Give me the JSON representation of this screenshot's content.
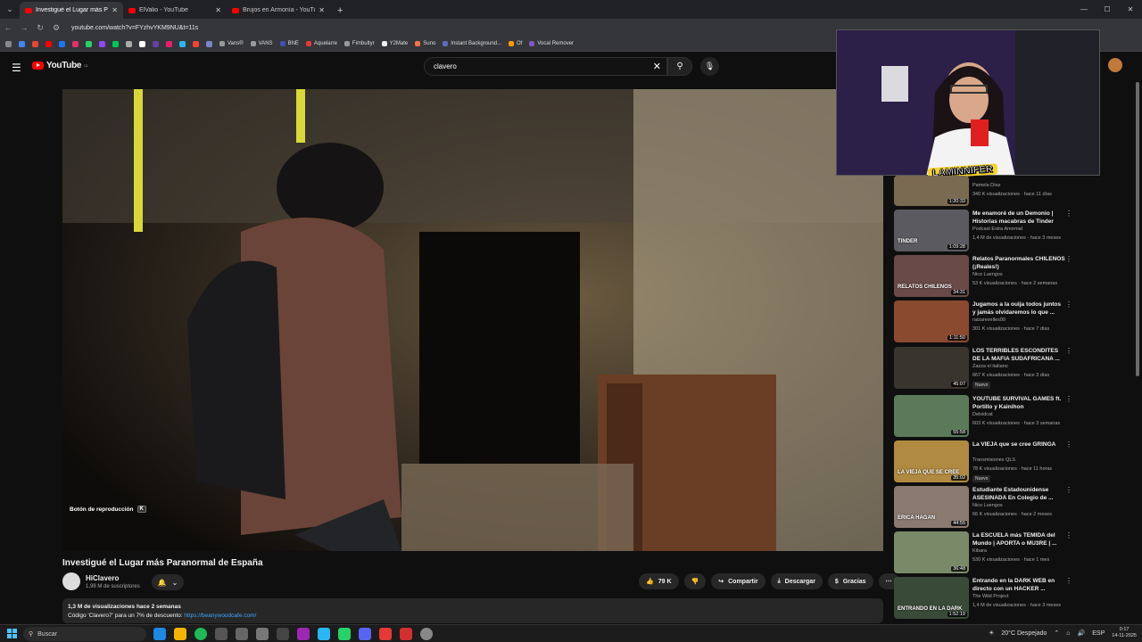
{
  "browser": {
    "tabs": [
      {
        "title": "Investigué el Lugar más Paranor",
        "active": true
      },
      {
        "title": "ElValio - YouTube",
        "active": false
      },
      {
        "title": "Brujos en Armonía - YouTube",
        "active": false
      }
    ],
    "url": "youtube.com/watch?v=FYzhvYKM9NU&t=11s",
    "bookmarks": [
      "Vans®",
      "VANS",
      "BNE",
      "Aquelarre",
      "Fimbultyr",
      "Y2Mate",
      "Suno",
      "Instant Background...",
      "Of",
      "Vocal Remover"
    ]
  },
  "youtube": {
    "logo": "YouTube",
    "region": "CL",
    "search_value": "clavero"
  },
  "video": {
    "overlay_label": "Botón de reproducción",
    "overlay_key": "K",
    "title": "Investigué el Lugar más Paranormal de España",
    "channel": "HiClavero",
    "subscribers": "1,98 M de suscriptores",
    "likes": "79 K",
    "share": "Compartir",
    "download": "Descargar",
    "thanks": "Gracias",
    "description_line1": "1,3 M de visualizaciones  hace 2 semanas",
    "description_line2": "Código 'Clavero7' para un 7% de descuento: ",
    "description_link": "https://beanywoodcafe.com/"
  },
  "webcam": {
    "tag": "LAMINNIFER"
  },
  "recommendations": [
    {
      "title": "",
      "channel": "Pamela Díaz",
      "meta": "340 K visualizaciones · hace 11 días",
      "duration": "1:20:33",
      "thumb": "#7a6a52",
      "badge": ""
    },
    {
      "title": "Me enamoré de un Demonio | Historias macabras de Tinder",
      "channel": "Podcast Extra Anormal",
      "meta": "1,4 M de visualizaciones · hace 3 meses",
      "duration": "1:09:28",
      "thumb": "#5a5a60",
      "thumb_text": "TINDER",
      "badge": ""
    },
    {
      "title": "Relatos Paranormales CHILENOS (¡Reales!)",
      "channel": "Nico Luengos",
      "meta": "53 K visualizaciones · hace 2 semanas",
      "duration": "34:31",
      "thumb": "#6a4a48",
      "thumb_text": "RELATOS CHILENOS",
      "badge": ""
    },
    {
      "title": "Jugamos a la ouija todos juntos y jamás olvidaremos lo que ...",
      "channel": "raizarevelles99",
      "meta": "301 K visualizaciones · hace 7 días",
      "duration": "1:11:50",
      "thumb": "#8a4a30",
      "badge": ""
    },
    {
      "title": "LOS TERRIBLES ESCONDITES DE LA MAFIA SUDAFRICANA ...",
      "channel": "Zazza el italiano",
      "meta": "667 K visualizaciones · hace 3 días",
      "duration": "45:07",
      "thumb": "#3a342e",
      "badge": "Nuevo"
    },
    {
      "title": "YOUTUBE SURVIVAL GAMES ft. Portillo y Kainihon",
      "channel": "Delvidcat",
      "meta": "603 K visualizaciones · hace 3 semanas",
      "duration": "55:58",
      "thumb": "#5a7a5a",
      "badge": ""
    },
    {
      "title": "La VIEJA que se cree GRINGA",
      "channel": "Transmisiones QLS",
      "meta": "78 K visualizaciones · hace 11 horas",
      "duration": "35:02",
      "thumb": "#b08a40",
      "thumb_text": "LA VIEJA QUE SE CREE",
      "badge": "Nuevo"
    },
    {
      "title": "Estudiante Estadounidense ASESINADA En Colegio de ...",
      "channel": "Nico Luengos",
      "meta": "66 K visualizaciones · hace 2 meses",
      "duration": "44:55",
      "thumb": "#8a7a70",
      "thumb_text": "ERICA HAGAN",
      "badge": ""
    },
    {
      "title": "La ESCUELA más TEMIDA del Mundo | APORTA o MU3RE | ...",
      "channel": "Kibara",
      "meta": "530 K visualizaciones · hace 1 mes",
      "duration": "36:48",
      "thumb": "#7a8a68",
      "badge": ""
    },
    {
      "title": "Entrando en la DARK WEB en directo con un HACKER ...",
      "channel": "The Wild Project",
      "meta": "1,4 M de visualizaciones · hace 3 meses",
      "duration": "1:52:19",
      "thumb": "#3a4a38",
      "thumb_text": "ENTRANDO EN LA DARK",
      "badge": ""
    }
  ],
  "taskbar": {
    "search_placeholder": "Buscar",
    "weather": "20°C  Despejado",
    "lang": "ESP",
    "time": "0:17",
    "date": "14-11-2025"
  },
  "colors": {
    "accent": "#ff0000",
    "link": "#3ea6ff"
  }
}
